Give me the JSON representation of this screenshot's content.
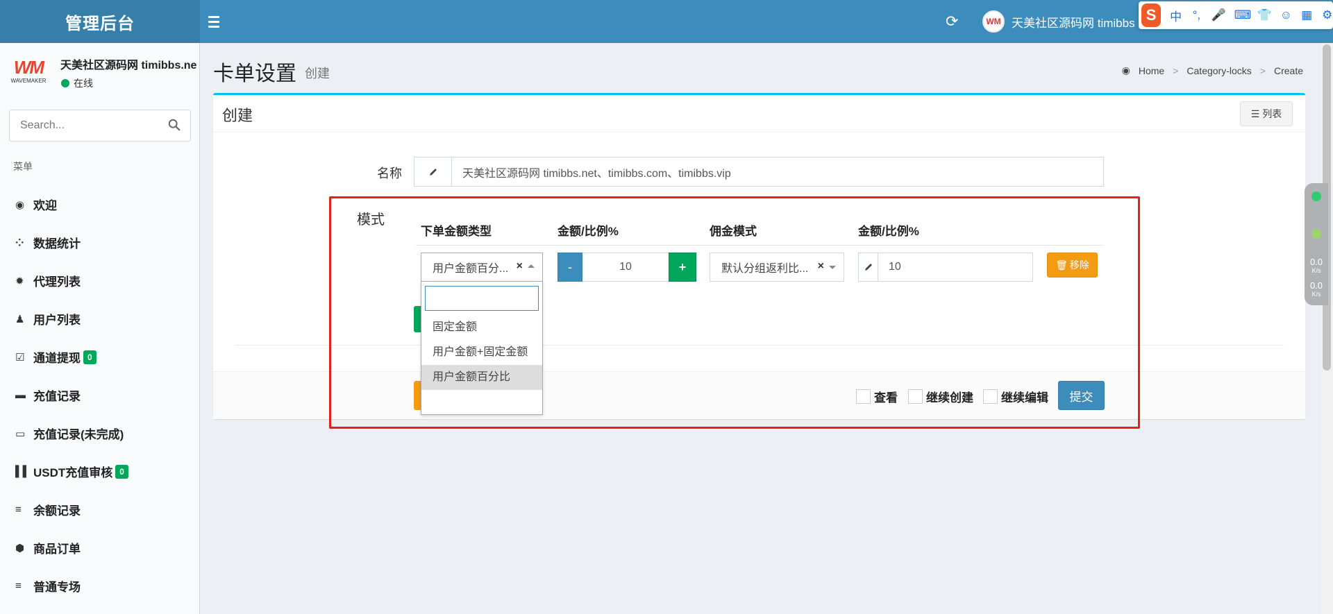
{
  "header": {
    "app_title": "管理后台",
    "username": "天美社区源码网 timibbs",
    "avatar_text": "WM",
    "ime_label": "S",
    "ime_items": [
      "中",
      "°,",
      "mic-icon",
      "keyboard-icon",
      "shirt-icon",
      "robot-icon",
      "grid-icon",
      "settings-icon"
    ],
    "ime_glyphs": [
      "中",
      "°,",
      "🎤",
      "⌨",
      "👕",
      "☺",
      "▦",
      "⚙"
    ]
  },
  "sidebar": {
    "brand_logo": "WM",
    "brand_sub": "WAVEMAKER",
    "user_name": "天美社区源码网 timibbs.ne",
    "status": "在线",
    "search_placeholder": "Search...",
    "menu_header": "菜单",
    "items": [
      {
        "label": "欢迎",
        "icon": "dashboard-icon",
        "glyph": "◉",
        "badge": ""
      },
      {
        "label": "数据统计",
        "icon": "stats-icon",
        "glyph": "⁘",
        "badge": ""
      },
      {
        "label": "代理列表",
        "icon": "gear-icon",
        "glyph": "✹",
        "badge": ""
      },
      {
        "label": "用户列表",
        "icon": "user-icon",
        "glyph": "♟",
        "badge": ""
      },
      {
        "label": "通道提现",
        "icon": "check-icon",
        "glyph": "☑",
        "badge": "0"
      },
      {
        "label": "充值记录",
        "icon": "battery-icon",
        "glyph": "▬",
        "badge": ""
      },
      {
        "label": "充值记录(未完成)",
        "icon": "battery-empty-icon",
        "glyph": "▭",
        "badge": ""
      },
      {
        "label": "USDT充值审核",
        "icon": "columns-icon",
        "glyph": "▌▌",
        "badge": "0"
      },
      {
        "label": "余额记录",
        "icon": "list-icon",
        "glyph": "≡",
        "badge": ""
      },
      {
        "label": "商品订单",
        "icon": "cube-icon",
        "glyph": "⬢",
        "badge": ""
      },
      {
        "label": "普通专场",
        "icon": "list-icon",
        "glyph": "≡",
        "badge": ""
      }
    ]
  },
  "page": {
    "title": "卡单设置",
    "subtitle": "创建",
    "breadcrumb": [
      "Home",
      "Category-locks",
      "Create"
    ]
  },
  "form": {
    "box_title": "创建",
    "list_button": "列表",
    "name_label": "名称",
    "name_value": "天美社区源码网 timibbs.net、timibbs.com、timibbs.vip",
    "mode_label": "模式",
    "columns": [
      "下单金额类型",
      "金额/比例%",
      "佣金模式",
      "金额/比例%"
    ],
    "row": {
      "amount_type": "用户金额百分...",
      "amount_value": "10",
      "minus": "-",
      "plus": "+",
      "commission_mode": "默认分组返利比...",
      "commission_value": "10",
      "remove_button": "移除"
    },
    "dropdown": {
      "options": [
        "固定金额",
        "用户金额+固定金额",
        "用户金额百分比"
      ],
      "selected": "用户金额百分比"
    },
    "checkboxes": [
      "查看",
      "继续创建",
      "继续编辑"
    ],
    "submit": "提交"
  },
  "network_widget": {
    "up": "0.0",
    "up_unit": "K/s",
    "down": "0.0",
    "down_unit": "K/s"
  }
}
